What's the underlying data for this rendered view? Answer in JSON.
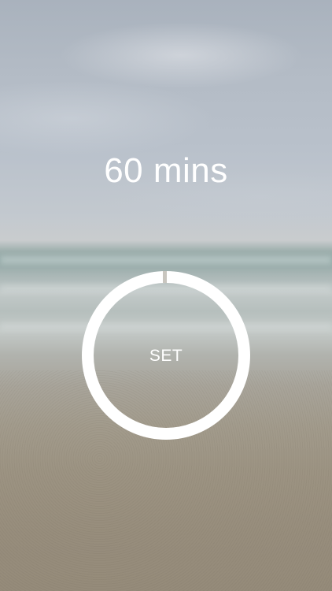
{
  "timer": {
    "duration_label": "60 mins",
    "set_label": "SET",
    "progress_fraction": 1.0
  },
  "background": {
    "scene": "beach-photo",
    "ring_color": "#ffffff",
    "handle_color": "#c9c6bf"
  }
}
